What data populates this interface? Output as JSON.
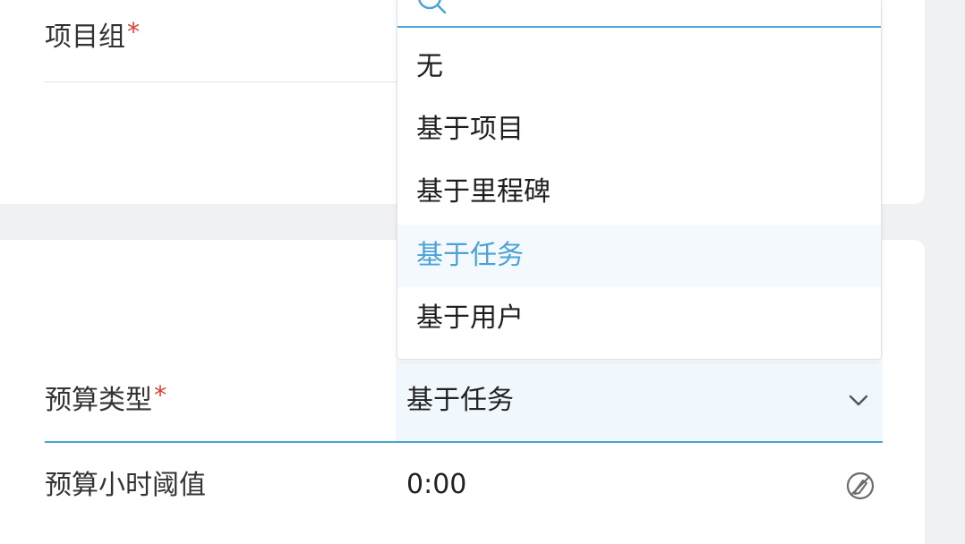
{
  "form": {
    "project_group": {
      "label": "项目组",
      "required_mark": "*"
    },
    "budget_type": {
      "label": "预算类型",
      "required_mark": "*",
      "selected_value": "基于任务"
    },
    "budget_hours_threshold": {
      "label": "预算小时阈值",
      "value": "0:00"
    }
  },
  "dropdown": {
    "options": [
      {
        "label": "无"
      },
      {
        "label": "基于项目"
      },
      {
        "label": "基于里程碑"
      },
      {
        "label": "基于任务",
        "selected": true
      },
      {
        "label": "基于用户"
      }
    ]
  },
  "icons": {
    "search": "search-icon",
    "chevron": "chevron-down-icon",
    "clear": "clear-icon"
  },
  "colors": {
    "accent": "#4aa2d9",
    "required": "#e23c2f",
    "selected_bg": "#f3f9fd"
  }
}
